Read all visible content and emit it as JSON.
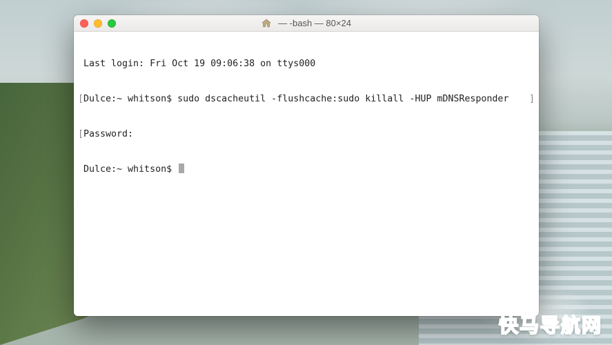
{
  "window": {
    "title": "— -bash — 80×24",
    "home_icon": "home-icon"
  },
  "terminal": {
    "lines": [
      "Last login: Fri Oct 19 09:06:38 on ttys000",
      "Dulce:~ whitson$ sudo dscacheutil -flushcache:sudo killall -HUP mDNSResponder",
      "Password:",
      "Dulce:~ whitson$ "
    ],
    "bracketed_line_index": 1
  },
  "watermark": "快马导航网"
}
